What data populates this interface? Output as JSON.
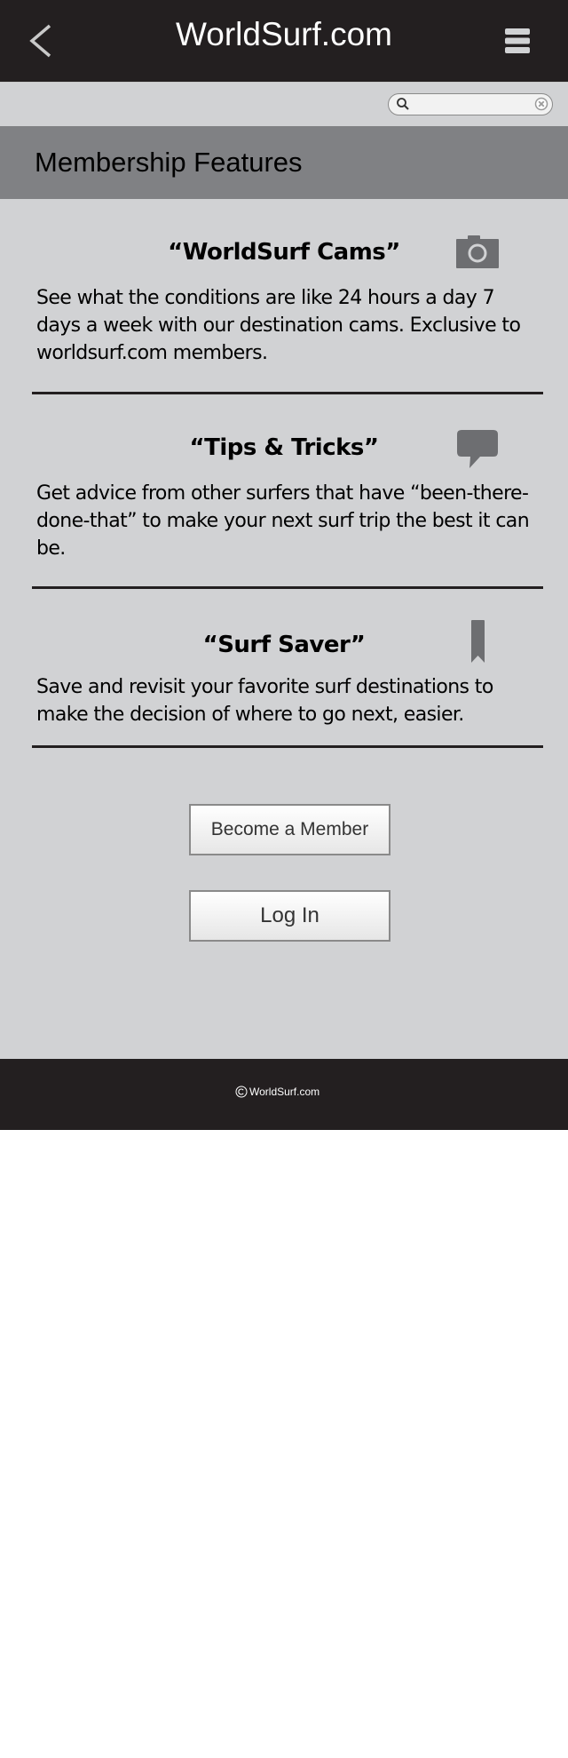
{
  "header": {
    "title": "WorldSurf.com"
  },
  "search": {
    "placeholder": "",
    "value": ""
  },
  "section": {
    "title": "Membership Features"
  },
  "features": [
    {
      "title": "“WorldSurf Cams”",
      "description": "See what the conditions are like 24 hours a day 7 days a week with our destination cams. Exclusive to worldsurf.com members.",
      "icon": "camera-icon"
    },
    {
      "title": "“Tips & Tricks”",
      "description": "Get advice from other surfers that have “been-there-done-that” to make your next surf trip the best it can be.",
      "icon": "speech-bubble-icon"
    },
    {
      "title": "“Surf Saver”",
      "description": "Save and revisit your favorite surf destinations to make the decision of where to go next, easier.",
      "icon": "bookmark-icon"
    }
  ],
  "buttons": {
    "become_member": "Become a Member",
    "log_in": "Log In"
  },
  "footer": {
    "text": "WorldSurf.com"
  },
  "colors": {
    "header_bg": "#231f20",
    "page_bg": "#d1d2d4",
    "section_bg": "#808184",
    "icon_gray": "#6d6e71"
  }
}
